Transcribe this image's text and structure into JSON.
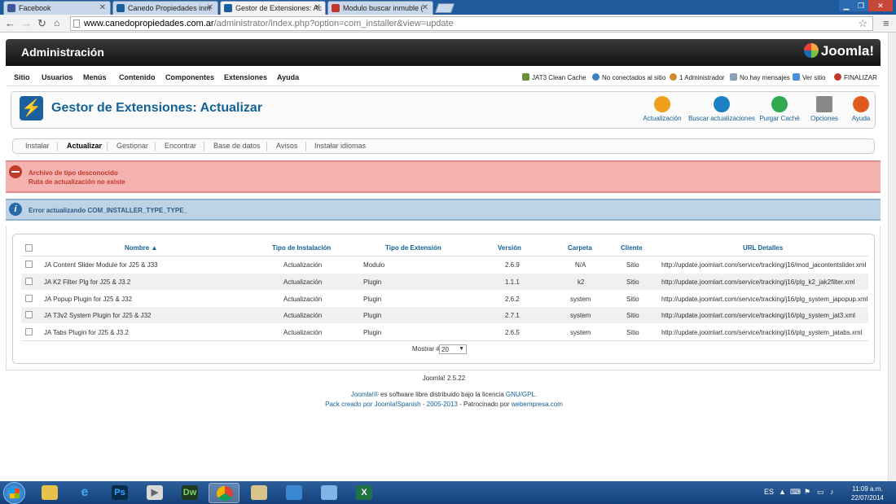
{
  "browser": {
    "tabs": [
      {
        "title": "Facebook",
        "color": "#3b5998"
      },
      {
        "title": "Canedo Propiedades inm",
        "color": "#1a5f9f"
      },
      {
        "title": "Gestor de Extensiones: Ac",
        "color": "#1a5f9f"
      },
      {
        "title": "Modulo buscar inmuble (",
        "color": "#c0392b"
      }
    ],
    "url_domain": "www.canedopropiedades.com.ar",
    "url_path": "/administrator/index.php?option=com_installer&view=update"
  },
  "header": {
    "title": "Administración",
    "logo_text": "Joomla!"
  },
  "menu": {
    "items": [
      "Sitio",
      "Usuarios",
      "Menús",
      "Contenido",
      "Componentes",
      "Extensiones",
      "Ayuda"
    ],
    "right": [
      "JAT3 Clean Cache",
      "No conectados al sitio",
      "1 Administrador",
      "No hay mensajes",
      "Ver sitio",
      "FINALIZAR"
    ]
  },
  "page": {
    "title": "Gestor de Extensiones: Actualizar"
  },
  "toolbar": [
    "Actualización",
    "Buscar actualizaciones",
    "Purgar Caché",
    "Opciones",
    "Ayuda"
  ],
  "submenu": {
    "items": [
      "Instalar",
      "Actualizar",
      "Gestionar",
      "Encontrar",
      "Base de datos",
      "Avisos",
      "Instalar idiomas"
    ],
    "active": "Actualizar"
  },
  "messages": {
    "error": [
      "Archivo de tipo desconocido",
      "Ruta de actualización no existe"
    ],
    "notice": "Error actualizando COM_INSTALLER_TYPE_TYPE_"
  },
  "table": {
    "headers": [
      "Nombre",
      "Tipo de Instalación",
      "Tipo de Extensión",
      "Versión",
      "Carpeta",
      "Cliente",
      "URL Detalles"
    ],
    "rows": [
      [
        "JA Content Slider Module for J25 & J33",
        "Actualización",
        "Modulo",
        "2.6.9",
        "N/A",
        "Sitio",
        "http://update.joomlart.com/service/tracking/j16/mod_jacontentslider.xml"
      ],
      [
        "JA K2 Filter Plg for J25 & J3.2",
        "Actualización",
        "Plugin",
        "1.1.1",
        "k2",
        "Sitio",
        "http://update.joomlart.com/service/tracking/j16/plg_k2_jak2filter.xml"
      ],
      [
        "JA Popup Plugin for J25 & J32",
        "Actualización",
        "Plugin",
        "2.6.2",
        "system",
        "Sitio",
        "http://update.joomlart.com/service/tracking/j16/plg_system_japopup.xml"
      ],
      [
        "JA T3v2 System Plugin for J25 & J32",
        "Actualización",
        "Plugin",
        "2.7.1",
        "system",
        "Sitio",
        "http://update.joomlart.com/service/tracking/j16/plg_system_jat3.xml"
      ],
      [
        "JA Tabs Plugin for J25 & J3.2",
        "Actualización",
        "Plugin",
        "2.6.5",
        "system",
        "Sitio",
        "http://update.joomlart.com/service/tracking/j16/plg_system_jatabs.xml"
      ]
    ],
    "show_label": "Mostrar #",
    "show_value": "20"
  },
  "footer": {
    "version": "Joomla! 2.5.22",
    "license_link": "Joomla!®",
    "license_text": " es software libre distribuido bajo la licencia ",
    "license_gpl": "GNU/GPL",
    "license_end": ".",
    "pack_link": "Pack creado por Joomla!Spanish - 2005-2013",
    "pack_text": " - Patrocinado por ",
    "sponsor": "webempresa.com"
  },
  "taskbar": {
    "apps": [
      "Explorador",
      "Internet Explorer",
      "Photoshop",
      "Media",
      "Dreamweaver",
      "Chrome",
      "Carpeta",
      "Red",
      "Outlook",
      "Excel"
    ],
    "lang": "ES",
    "time": "11:09 a.m.",
    "date": "22/07/2014"
  }
}
